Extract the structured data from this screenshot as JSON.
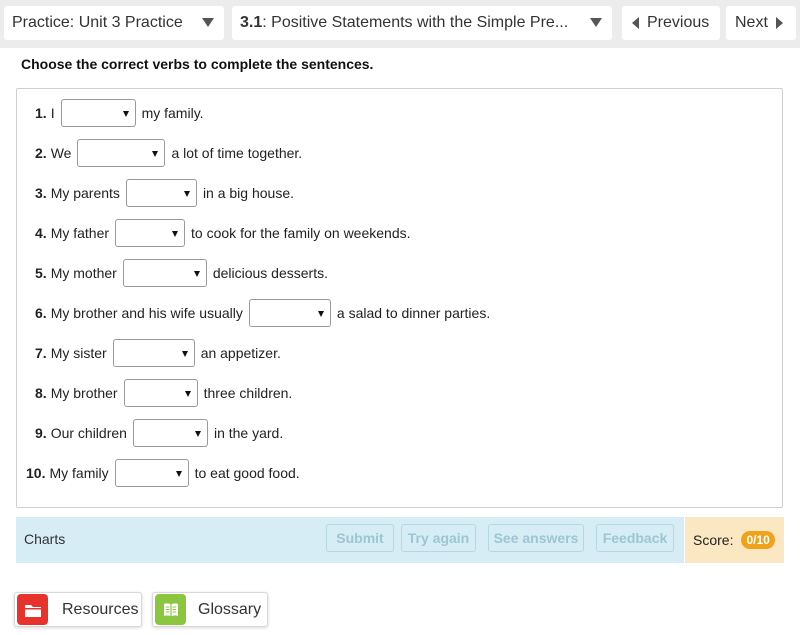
{
  "topbar": {
    "practice_selector": "Practice: Unit 3 Practice",
    "lesson_number": "3.1",
    "lesson_title": ": Positive Statements with the Simple Pre...",
    "previous_label": "Previous",
    "next_label": "Next"
  },
  "instruction": "Choose the correct verbs to complete the sentences.",
  "questions": [
    {
      "num": "1.",
      "before": "I",
      "after": "my family."
    },
    {
      "num": "2.",
      "before": "We",
      "after": "a lot of time together."
    },
    {
      "num": "3.",
      "before": "My parents",
      "after": "in a big house."
    },
    {
      "num": "4.",
      "before": "My father",
      "after": "to cook for the family on weekends."
    },
    {
      "num": "5.",
      "before": "My mother",
      "after": "delicious desserts."
    },
    {
      "num": "6.",
      "before": "My brother and his wife usually",
      "after": "a salad to dinner parties."
    },
    {
      "num": "7.",
      "before": "My sister",
      "after": "an appetizer."
    },
    {
      "num": "8.",
      "before": "My brother",
      "after": "three children."
    },
    {
      "num": "9.",
      "before": "Our children",
      "after": "in the yard."
    },
    {
      "num": "10.",
      "before": "My family",
      "after": "to eat good food."
    }
  ],
  "actions": {
    "charts_label": "Charts",
    "submit_label": "Submit",
    "try_again_label": "Try again",
    "see_answers_label": "See answers",
    "feedback_label": "Feedback"
  },
  "score": {
    "label": "Score:",
    "value": "0/10"
  },
  "tools": {
    "resources_label": "Resources",
    "glossary_label": "Glossary"
  },
  "colors": {
    "action_bar": "#d6edf5",
    "score_bg": "#fbe8c2",
    "score_pill": "#f0a21a",
    "resources_icon": "#e8332c",
    "glossary_icon": "#8cc63f"
  }
}
